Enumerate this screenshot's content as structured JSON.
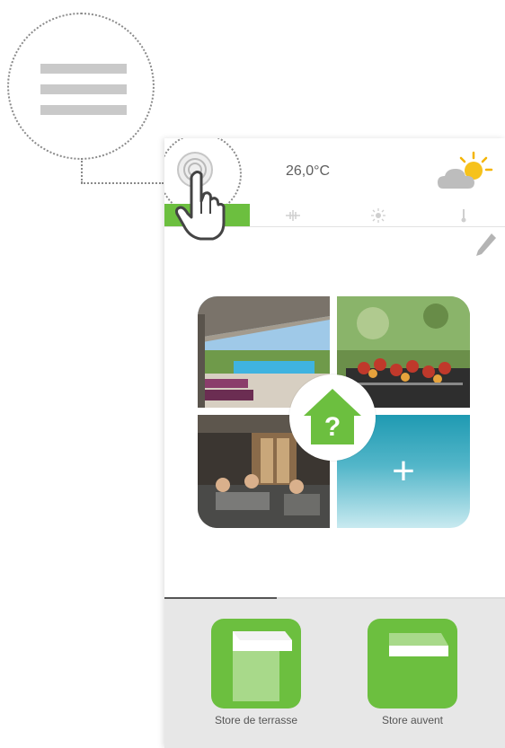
{
  "header": {
    "temperature": "26,0°C",
    "weather_icon": "partly-sunny-icon",
    "menu_icon": "hamburger-menu-icon"
  },
  "tabs": [
    {
      "icon": "star-icon",
      "active": true
    },
    {
      "icon": "wind-icon",
      "active": false
    },
    {
      "icon": "sun-icon",
      "active": false
    },
    {
      "icon": "thermometer-icon",
      "active": false
    }
  ],
  "scenes": {
    "tiles": [
      {
        "icon": "terrace-pool-photo"
      },
      {
        "icon": "barbecue-photo"
      },
      {
        "icon": "evening-terrace-photo"
      },
      {
        "icon": "plus-icon",
        "label": "+"
      }
    ],
    "center_icon": "home-help-icon",
    "center_label": "?"
  },
  "pager": {
    "progress": 0.33
  },
  "devices": [
    {
      "label": "Store de terrasse",
      "icon": "terrace-awning-icon"
    },
    {
      "label": "Store auvent",
      "icon": "canopy-awning-icon"
    }
  ],
  "colors": {
    "accent": "#6cbf3f",
    "bottom_bar": "#e7e7e7",
    "water_tile": "#1f9ab2"
  }
}
